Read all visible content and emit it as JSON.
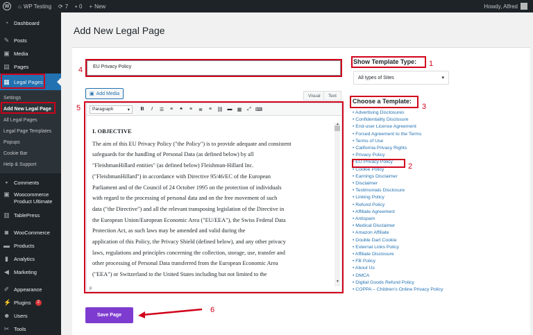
{
  "adminbar": {
    "site_name": "WP Testing",
    "updates": "7",
    "comments": "0",
    "new_label": "New",
    "howdy": "Howdy, Alfred"
  },
  "sidebar": {
    "dashboard": "Dashboard",
    "posts": "Posts",
    "media": "Media",
    "pages": "Pages",
    "legal_pages": "Legal Pages",
    "submenu": [
      "Settings",
      "Add New Legal Page",
      "All Legal Pages",
      "Legal Page Templates",
      "Popups",
      "Cookie Bar",
      "Help & Support"
    ],
    "comments": "Comments",
    "woo_ultimate_1": "Woocommerce",
    "woo_ultimate_2": "Product Ultimate",
    "tablepress": "TablePress",
    "woocommerce": "WooCommerce",
    "products": "Products",
    "analytics": "Analytics",
    "marketing": "Marketing",
    "appearance": "Appearance",
    "plugins": "Plugins",
    "plugins_badge": "2",
    "users": "Users",
    "tools": "Tools"
  },
  "main": {
    "page_title": "Add New Legal Page",
    "title_value": "EU Privacy Policy",
    "add_media": "Add Media",
    "tab_visual": "Visual",
    "tab_text": "Text",
    "format_select": "Paragraph",
    "editor_heading": "I. OBJECTIVE",
    "editor_lines": [
      "The aim of this EU Privacy Policy (\"the Policy\") is to provide adequate and consistent",
      "safeguards for the handling of Personal Data (as defined below) by all",
      "\"FleishmanHillard entities\" (as defined below) Fleishman-Hillard Inc.",
      "(\"FleishmanHillard\") in accordance with Directive 95/46/EC of the European",
      "Parliament and of the Council of 24 October 1995 on the protection of individuals",
      "with regard to the processing of personal data and on the free movement of such",
      "data (\"the Directive\") and all the relevant transposing legislation of the Directive in",
      "the European Union/European Economic Area (\"EU/EEA\"), the Swiss Federal Data",
      "Protection Act, as such laws may be amended and valid during the",
      "application of this Policy, the Privacy Shield (defined below), and any other privacy",
      "laws, regulations and principles concerning the collection, storage, use, transfer and",
      "other processing of Personal Data transferred from the European Economic Area",
      "(\"EEA\") or Switzerland to the United States including but not limited to the"
    ],
    "editor_footer": "p",
    "save_button": "Save Page"
  },
  "templates": {
    "show_type_label": "Show Template Type:",
    "type_select_value": "All types of Sites",
    "choose_label": "Choose a Template:",
    "items": [
      "Advertising Disclosures",
      "Confidentiality Disclosure",
      "End-user License Agreement",
      "Forced Agreement to the Terms",
      "Terms of Use",
      "California Privacy Rights",
      "Privacy Policy",
      "EU Privacy Policy",
      "Cookie Policy",
      "Earnings Disclaimer",
      "Disclaimer",
      "Testimonials Disclosure",
      "Linking Policy",
      "Refund Policy",
      "Affiliate Agreement",
      "Antispam",
      "Medical Disclaimer",
      "Amazon Affiliate",
      "Double Dart Cookie",
      "External Links Policy",
      "Affiliate Disclosure",
      "FB Policy",
      "About Us",
      "DMCA",
      "Digital Goods Refund Policy",
      "COPPA – Children's Online Privacy Policy"
    ]
  },
  "annotations": [
    "1",
    "2",
    "3",
    "4",
    "5",
    "6"
  ],
  "colors": {
    "accent": "#2271b1",
    "highlight": "#d0021b",
    "save": "#7e3bd0"
  }
}
